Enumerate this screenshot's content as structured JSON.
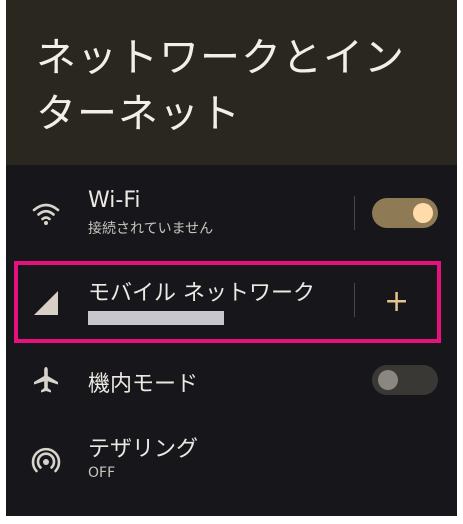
{
  "page": {
    "title": "ネットワークとインターネット"
  },
  "settings": {
    "wifi": {
      "title": "Wi-Fi",
      "subtitle": "接続されていません",
      "icon": "wifi-icon",
      "toggle": "on"
    },
    "mobile_network": {
      "title": "モバイル ネットワーク",
      "icon": "cell-signal-icon",
      "action": "+"
    },
    "airplane_mode": {
      "title": "機内モード",
      "icon": "airplane-icon",
      "toggle": "off"
    },
    "tethering": {
      "title": "テザリング",
      "subtitle": "OFF",
      "icon": "hotspot-icon"
    }
  },
  "colors": {
    "background": "#17171b",
    "header": "#2a2620",
    "accent": "#ffdcaa",
    "highlight": "#e6107f"
  }
}
